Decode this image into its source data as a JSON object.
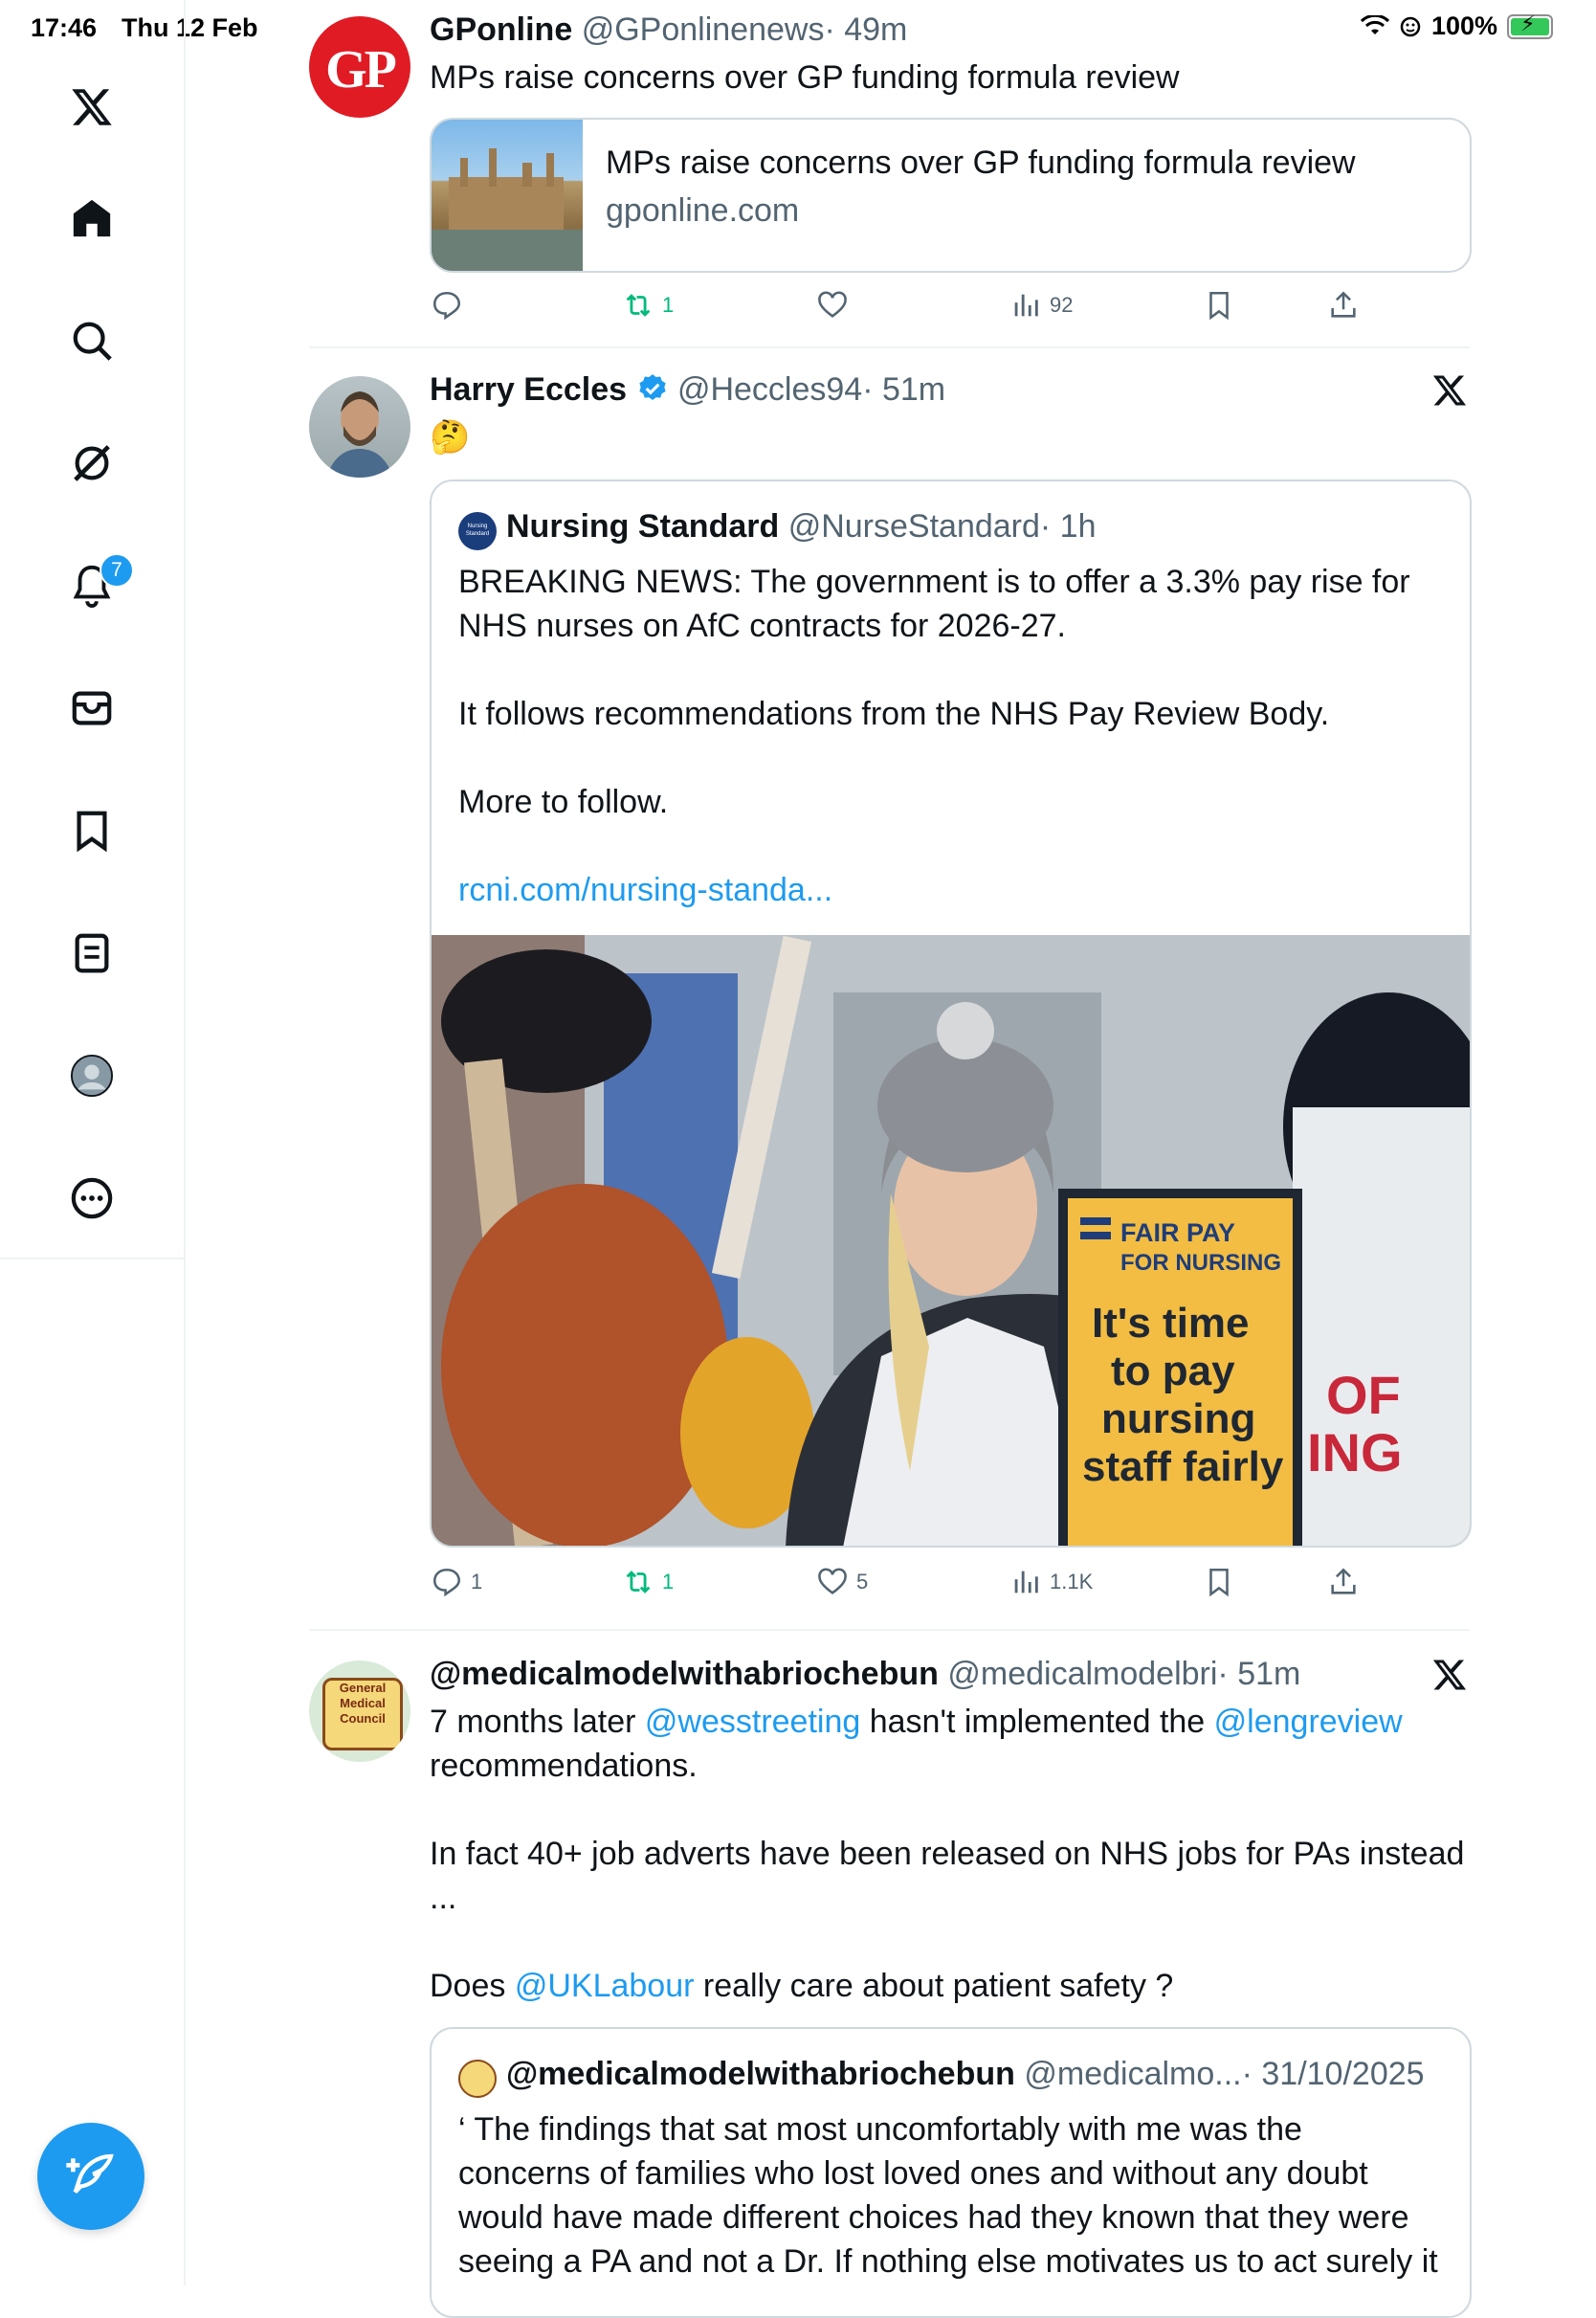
{
  "status_bar": {
    "time": "17:46",
    "date": "Thu 12 Feb",
    "battery": "100%",
    "battery_level": 1.0
  },
  "sidebar": {
    "items": [
      {
        "name": "x-logo-icon"
      },
      {
        "name": "home-icon"
      },
      {
        "name": "search-icon"
      },
      {
        "name": "grok-icon"
      },
      {
        "name": "notifications-icon",
        "badge": "7"
      },
      {
        "name": "messages-icon"
      },
      {
        "name": "bookmarks-icon"
      },
      {
        "name": "lists-icon"
      },
      {
        "name": "profile-icon"
      },
      {
        "name": "more-icon"
      }
    ],
    "compose_icon": "compose-icon"
  },
  "tweets": [
    {
      "name": "GPonline",
      "handle": "@GPonlinenews",
      "time": "· 49m",
      "text": "MPs raise concerns over GP funding formula review",
      "avatar_text": "GP",
      "card": {
        "title": "MPs raise concerns over GP funding formula review",
        "domain": "gponline.com"
      },
      "stats": {
        "replies": "",
        "reposts": "1",
        "likes": "",
        "views": "92"
      }
    },
    {
      "name": "Harry Eccles",
      "handle": "@Heccles94",
      "time": "· 51m",
      "verified": true,
      "text": "🤔",
      "quote": {
        "name": "Nursing Standard",
        "handle": "@NurseStandard",
        "time": "· 1h",
        "avatar_text": "Nursing Standard",
        "lines": [
          "BREAKING NEWS: The government is to offer a 3.3% pay rise for",
          "NHS nurses on AfC contracts for 2026-27.",
          "It follows recommendations from the NHS Pay Review Body.",
          "More to follow."
        ],
        "link": "rcni.com/nursing-standa...",
        "sign": {
          "top1": "FAIR PAY",
          "top2": "FOR NURSING",
          "l1": "It's time",
          "l2": "to pay",
          "l3": "nursing",
          "l4": "staff fairly",
          "bg_text1": "OF",
          "bg_text2": "ING"
        }
      },
      "stats": {
        "replies": "1",
        "reposts": "1",
        "likes": "5",
        "views": "1.1K"
      }
    },
    {
      "name": "@medicalmodelwithabriochebun",
      "handle": "@medicalmodelbri",
      "time": "· 51m",
      "avatar_text": "General Medical Council",
      "text_parts": {
        "p1a": "7 months later ",
        "m1": "@wesstreeting",
        "p1b": " hasn't implemented the ",
        "m2": "@lengreview",
        "p1c": "recommendations.",
        "p2a": "In fact 40+ job adverts have been released on NHS jobs for PAs instead",
        "p2b": "...",
        "p3a": "Does ",
        "m3": "@UKLabour",
        "p3b": " really care about patient safety ?"
      },
      "quote": {
        "name": "@medicalmodelwithabriochebun",
        "handle": "@medicalmo...",
        "time": "· 31/10/2025",
        "lines": [
          "‘ The findings that sat most uncomfortably with me was the",
          "concerns of families who lost loved ones and without any doubt",
          "would have made different choices had they known that they were",
          "seeing a PA and not a Dr. If nothing else motivates us to act surely it"
        ]
      }
    }
  ]
}
